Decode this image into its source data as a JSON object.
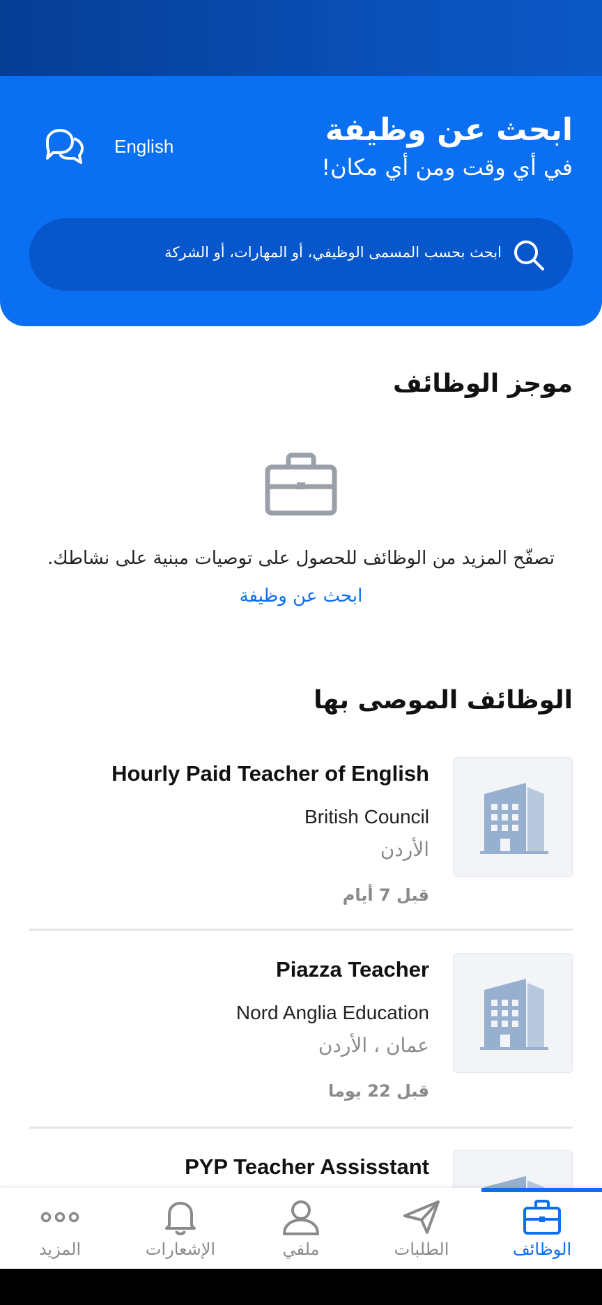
{
  "header": {
    "title": "ابحث عن وظيفة",
    "subtitle": "في أي وقت ومن أي مكان!",
    "language_link": "English",
    "chat_icon": "chat-bubbles-icon"
  },
  "search": {
    "placeholder": "ابحث بحسب المسمى الوظيفي، أو المهارات، أو الشركة",
    "icon": "search-icon"
  },
  "job_feed": {
    "title": "موجز الوظائف",
    "empty_icon": "briefcase-icon",
    "empty_text": "تصفّح المزيد من الوظائف للحصول على توصيات مبنية على نشاطك.",
    "empty_link": "ابحث عن وظيفة"
  },
  "recommended": {
    "title": "الوظائف الموصى بها",
    "jobs": [
      {
        "title": "Hourly Paid Teacher of English",
        "company": "British Council",
        "location": "الأردن",
        "posted": "قبل 7 أيام"
      },
      {
        "title": "Piazza Teacher",
        "company": "Nord Anglia Education",
        "location": "عمان ، الأردن",
        "posted": "قبل 22 يوما"
      },
      {
        "title": "PYP Teacher Assisstant",
        "company": "",
        "location": "",
        "posted": ""
      }
    ]
  },
  "bottom_nav": {
    "items": [
      {
        "label": "الوظائف",
        "icon": "briefcase-icon",
        "active": true
      },
      {
        "label": "الطلبات",
        "icon": "paper-plane-icon",
        "active": false
      },
      {
        "label": "ملفي",
        "icon": "user-icon",
        "active": false
      },
      {
        "label": "الإشعارات",
        "icon": "bell-icon",
        "active": false
      },
      {
        "label": "المزيد",
        "icon": "more-dots-icon",
        "active": false
      }
    ]
  },
  "colors": {
    "primary": "#0a6ff0",
    "header_dark": "#0756cc",
    "status_bar": "#053d93",
    "muted": "#8a8a8a"
  }
}
